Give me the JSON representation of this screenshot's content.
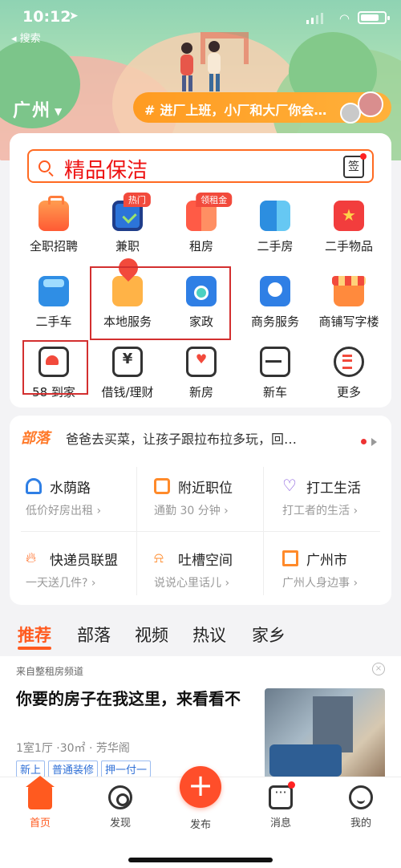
{
  "status": {
    "time": "10:12",
    "back_label": "◂ 搜索"
  },
  "header": {
    "city": "广州",
    "promo_hash": "#",
    "promo_text": "进厂上班，小厂和大厂你会…"
  },
  "search": {
    "query": "精品保洁",
    "sign_label": "签"
  },
  "grid": {
    "row1": [
      {
        "label": "全职招聘",
        "icon": "briefcase-icon"
      },
      {
        "label": "兼职",
        "icon": "clock-icon",
        "badge": "热门"
      },
      {
        "label": "租房",
        "icon": "rent-icon",
        "badge": "领租金"
      },
      {
        "label": "二手房",
        "icon": "house-icon"
      },
      {
        "label": "二手物品",
        "icon": "bag-icon"
      }
    ],
    "row2": [
      {
        "label": "二手车",
        "icon": "car-icon"
      },
      {
        "label": "本地服务",
        "icon": "location-pin-icon"
      },
      {
        "label": "家政",
        "icon": "washer-icon"
      },
      {
        "label": "商务服务",
        "icon": "business-icon"
      },
      {
        "label": "商铺写字楼",
        "icon": "shop-icon"
      }
    ],
    "row3": [
      {
        "label": "58 到家",
        "icon": "home-service-icon"
      },
      {
        "label": "借钱/理财",
        "icon": "yen-icon"
      },
      {
        "label": "新房",
        "icon": "heart-house-icon"
      },
      {
        "label": "新车",
        "icon": "new-car-icon"
      },
      {
        "label": "更多",
        "icon": "more-icon"
      }
    ]
  },
  "community": {
    "tag": "部落",
    "headline": "爸爸去买菜，让孩子跟拉布拉多玩，回…",
    "cells": [
      {
        "title": "水荫路",
        "sub": "低价好房出租 ›"
      },
      {
        "title": "附近职位",
        "sub": "通勤 30 分钟 ›"
      },
      {
        "title": "打工生活",
        "sub": "打工者的生活 ›"
      },
      {
        "title": "快递员联盟",
        "sub": "一天送几件? ›"
      },
      {
        "title": "吐槽空间",
        "sub": "说说心里话儿 ›"
      },
      {
        "title": "广州市",
        "sub": "广州人身边事 ›"
      }
    ]
  },
  "tabs": [
    "推荐",
    "部落",
    "视频",
    "热议",
    "家乡"
  ],
  "feed": {
    "source": "来自整租房频道",
    "title": "你要的房子在我这里，来看看不",
    "meta": "1室1厅 ·30㎡ · 芳华阁",
    "tags": [
      "新上",
      "普通装修",
      "押一付一"
    ]
  },
  "bottom_nav": {
    "home": "首页",
    "discover": "发现",
    "publish": "发布",
    "messages": "消息",
    "mine": "我的"
  },
  "colors": {
    "accent": "#ff5a1f",
    "promo": "#ffa12c",
    "highlight_box": "#d32f2f"
  }
}
